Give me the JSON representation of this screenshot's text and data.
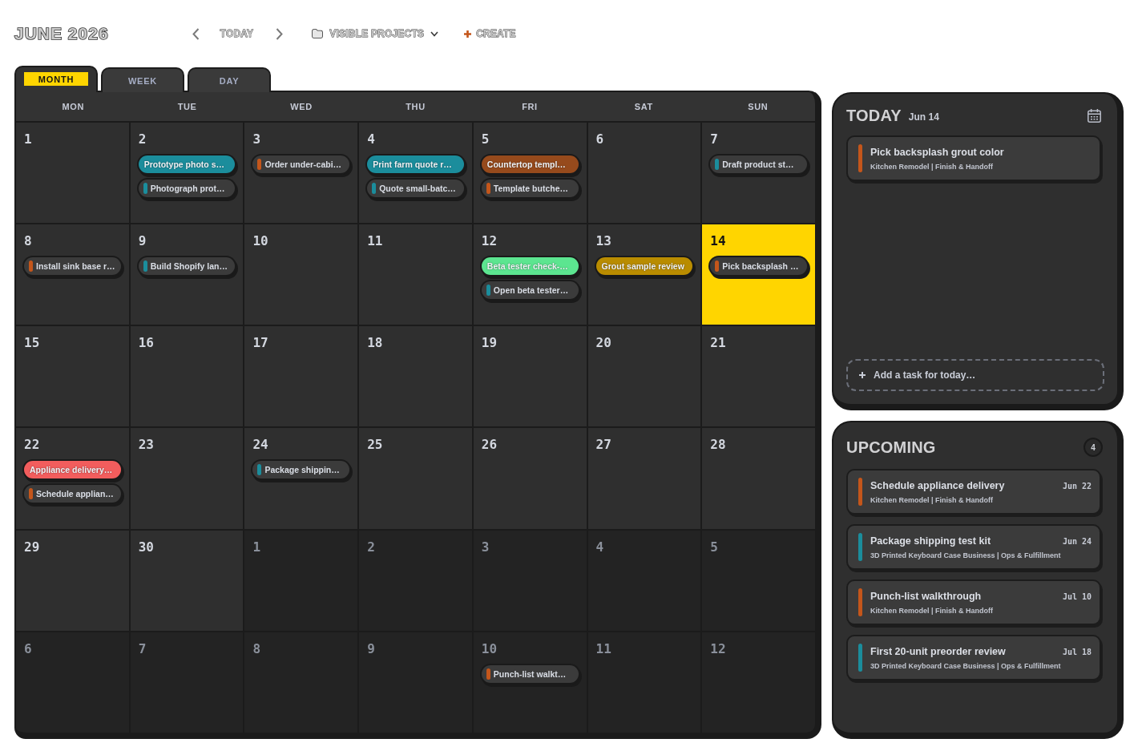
{
  "header": {
    "title": "JUNE 2026",
    "today_button": "TODAY",
    "projects_filter": "VISIBLE PROJECTS",
    "create_button": "CREATE"
  },
  "view_tabs": [
    {
      "label": "MONTH",
      "selected": true
    },
    {
      "label": "WEEK",
      "selected": false
    },
    {
      "label": "DAY",
      "selected": false
    }
  ],
  "calendar": {
    "weekdays": [
      "MON",
      "TUE",
      "WED",
      "THU",
      "FRI",
      "SAT",
      "SUN"
    ],
    "weeks": [
      [
        {
          "day": "1",
          "in_month": true,
          "today": false
        },
        {
          "day": "2",
          "in_month": true,
          "today": false,
          "events": [
            {
              "title": "Prototype photo s…",
              "kind": "filled",
              "color": "#1b8d9c"
            },
            {
              "title": "Photograph prot…",
              "kind": "bar",
              "color": "#1b8d9c"
            }
          ]
        },
        {
          "day": "3",
          "in_month": true,
          "today": false,
          "events": [
            {
              "title": "Order under-cabi…",
              "kind": "bar",
              "color": "#c4561b"
            }
          ]
        },
        {
          "day": "4",
          "in_month": true,
          "today": false,
          "events": [
            {
              "title": "Print farm quote r…",
              "kind": "filled",
              "color": "#1b8d9c"
            },
            {
              "title": "Quote small-batc…",
              "kind": "bar",
              "color": "#1b8d9c"
            }
          ]
        },
        {
          "day": "5",
          "in_month": true,
          "today": false,
          "events": [
            {
              "title": "Countertop templ…",
              "kind": "filled",
              "color": "#964a1c"
            },
            {
              "title": "Template butche…",
              "kind": "bar",
              "color": "#c4561b"
            }
          ]
        },
        {
          "day": "6",
          "in_month": true,
          "today": false
        },
        {
          "day": "7",
          "in_month": true,
          "today": false,
          "events": [
            {
              "title": "Draft product st…",
              "kind": "bar",
              "color": "#1b8d9c"
            }
          ]
        }
      ],
      [
        {
          "day": "8",
          "in_month": true,
          "today": false,
          "events": [
            {
              "title": "Install sink base r…",
              "kind": "bar",
              "color": "#c4561b"
            }
          ]
        },
        {
          "day": "9",
          "in_month": true,
          "today": false,
          "events": [
            {
              "title": "Build Shopify lan…",
              "kind": "bar",
              "color": "#1b8d9c"
            }
          ]
        },
        {
          "day": "10",
          "in_month": true,
          "today": false
        },
        {
          "day": "11",
          "in_month": true,
          "today": false
        },
        {
          "day": "12",
          "in_month": true,
          "today": false,
          "events": [
            {
              "title": "Beta tester check-…",
              "kind": "filled",
              "color": "#5ce590"
            },
            {
              "title": "Open beta tester…",
              "kind": "bar",
              "color": "#1b8d9c"
            }
          ]
        },
        {
          "day": "13",
          "in_month": true,
          "today": false,
          "events": [
            {
              "title": "Grout sample review",
              "kind": "filled",
              "color": "#b98c00"
            }
          ]
        },
        {
          "day": "14",
          "in_month": true,
          "today": true,
          "events": [
            {
              "title": "Pick backsplash …",
              "kind": "bar",
              "color": "#c4561b"
            }
          ]
        }
      ],
      [
        {
          "day": "15",
          "in_month": true,
          "today": false
        },
        {
          "day": "16",
          "in_month": true,
          "today": false
        },
        {
          "day": "17",
          "in_month": true,
          "today": false
        },
        {
          "day": "18",
          "in_month": true,
          "today": false
        },
        {
          "day": "19",
          "in_month": true,
          "today": false
        },
        {
          "day": "20",
          "in_month": true,
          "today": false
        },
        {
          "day": "21",
          "in_month": true,
          "today": false
        }
      ],
      [
        {
          "day": "22",
          "in_month": true,
          "today": false,
          "events": [
            {
              "title": "Appliance delivery…",
              "kind": "filled",
              "color": "#f25d5d"
            },
            {
              "title": "Schedule applian…",
              "kind": "bar",
              "color": "#c4561b"
            }
          ]
        },
        {
          "day": "23",
          "in_month": true,
          "today": false
        },
        {
          "day": "24",
          "in_month": true,
          "today": false,
          "events": [
            {
              "title": "Package shippin…",
              "kind": "bar",
              "color": "#1b8d9c"
            }
          ]
        },
        {
          "day": "25",
          "in_month": true,
          "today": false
        },
        {
          "day": "26",
          "in_month": true,
          "today": false
        },
        {
          "day": "27",
          "in_month": true,
          "today": false
        },
        {
          "day": "28",
          "in_month": true,
          "today": false
        }
      ],
      [
        {
          "day": "29",
          "in_month": true,
          "today": false
        },
        {
          "day": "30",
          "in_month": true,
          "today": false
        },
        {
          "day": "1",
          "in_month": false,
          "today": false
        },
        {
          "day": "2",
          "in_month": false,
          "today": false
        },
        {
          "day": "3",
          "in_month": false,
          "today": false
        },
        {
          "day": "4",
          "in_month": false,
          "today": false
        },
        {
          "day": "5",
          "in_month": false,
          "today": false
        }
      ],
      [
        {
          "day": "6",
          "in_month": false,
          "today": false
        },
        {
          "day": "7",
          "in_month": false,
          "today": false
        },
        {
          "day": "8",
          "in_month": false,
          "today": false
        },
        {
          "day": "9",
          "in_month": false,
          "today": false
        },
        {
          "day": "10",
          "in_month": false,
          "today": false,
          "events": [
            {
              "title": "Punch-list walkt…",
              "kind": "bar",
              "color": "#c4561b"
            }
          ]
        },
        {
          "day": "11",
          "in_month": false,
          "today": false
        },
        {
          "day": "12",
          "in_month": false,
          "today": false
        }
      ]
    ]
  },
  "today_panel": {
    "title": "TODAY",
    "date": "Jun 14",
    "tasks": [
      {
        "title": "Pick backsplash grout color",
        "project": "Kitchen Remodel | Finish & Handoff",
        "color": "#c4561b"
      }
    ],
    "add_task": "Add a task for today…"
  },
  "upcoming": {
    "title": "UPCOMING",
    "count": "4",
    "tasks": [
      {
        "title": "Schedule appliance delivery",
        "project": "Kitchen Remodel | Finish & Handoff",
        "date": "Jun 22",
        "color": "#c4561b"
      },
      {
        "title": "Package shipping test kit",
        "project": "3D Printed Keyboard Case Business | Ops & Fulfillment",
        "date": "Jun 24",
        "color": "#1b8d9c"
      },
      {
        "title": "Punch-list walkthrough",
        "project": "Kitchen Remodel | Finish & Handoff",
        "date": "Jul 10",
        "color": "#c4561b"
      },
      {
        "title": "First 20-unit preorder review",
        "project": "3D Printed Keyboard Case Business | Ops & Fulfillment",
        "date": "Jul 18",
        "color": "#1b8d9c"
      }
    ]
  }
}
